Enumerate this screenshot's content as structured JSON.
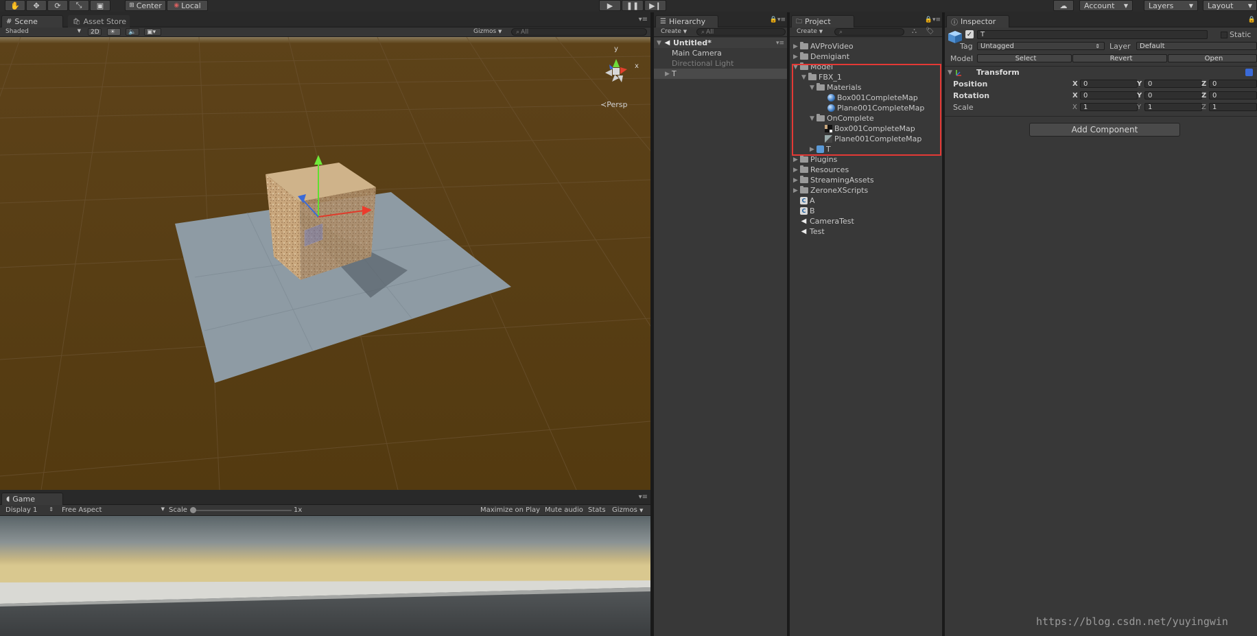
{
  "toolbar": {
    "pivot_label": "Center",
    "space_label": "Local",
    "account_label": "Account",
    "layers_label": "Layers",
    "layout_label": "Layout"
  },
  "scene": {
    "tab_label": "Scene",
    "asset_store_tab": "Asset Store",
    "shading_mode": "Shaded",
    "mode_2d": "2D",
    "gizmos_label": "Gizmos",
    "search_placeholder": "All",
    "projection_label": "Persp",
    "axis_x": "x",
    "axis_y": "y"
  },
  "game": {
    "tab_label": "Game",
    "display": "Display 1",
    "aspect": "Free Aspect",
    "scale_label": "Scale",
    "scale_value": "1x",
    "maximize_on_play": "Maximize on Play",
    "mute_audio": "Mute audio",
    "stats": "Stats",
    "gizmos": "Gizmos"
  },
  "hierarchy": {
    "tab_label": "Hierarchy",
    "create_label": "Create",
    "search_placeholder": "All",
    "scene_name": "Untitled*",
    "items": [
      {
        "label": "Main Camera"
      },
      {
        "label": "Directional Light"
      },
      {
        "label": "T"
      }
    ]
  },
  "project": {
    "tab_label": "Project",
    "create_label": "Create",
    "items": [
      {
        "label": "AVProVideo"
      },
      {
        "label": "Demigiant"
      },
      {
        "label": "Model"
      },
      {
        "label": "FBX_1"
      },
      {
        "label": "Materials"
      },
      {
        "label": "Box001CompleteMap"
      },
      {
        "label": "Plane001CompleteMap"
      },
      {
        "label": "OnComplete"
      },
      {
        "label": "Box001CompleteMap"
      },
      {
        "label": "Plane001CompleteMap"
      },
      {
        "label": "T"
      },
      {
        "label": "Plugins"
      },
      {
        "label": "Resources"
      },
      {
        "label": "StreamingAssets"
      },
      {
        "label": "ZeroneXScripts"
      },
      {
        "label": "A"
      },
      {
        "label": "B"
      },
      {
        "label": "CameraTest"
      },
      {
        "label": "Test"
      }
    ],
    "script_glyph": "C",
    "unity_glyph": "◀"
  },
  "inspector": {
    "tab_label": "Inspector",
    "object_name": "T",
    "static_label": "Static",
    "tag_label": "Tag",
    "tag_value": "Untagged",
    "layer_label": "Layer",
    "layer_value": "Default",
    "model_label": "Model",
    "select_label": "Select",
    "revert_label": "Revert",
    "open_label": "Open",
    "component_title": "Transform",
    "position_label": "Position",
    "rotation_label": "Rotation",
    "scale_label": "Scale",
    "axis_x": "X",
    "axis_y": "Y",
    "axis_z": "Z",
    "position": {
      "x": "0",
      "y": "0",
      "z": "0"
    },
    "rotation": {
      "x": "0",
      "y": "0",
      "z": "0"
    },
    "scale": {
      "x": "1",
      "y": "1",
      "z": "1"
    },
    "add_component_label": "Add Component"
  },
  "watermark": "https://blog.csdn.net/yuyingwin",
  "colors": {
    "scene_ground": "#5a3f15",
    "highlight_box": "#e53935",
    "panel_bg": "#383838"
  }
}
